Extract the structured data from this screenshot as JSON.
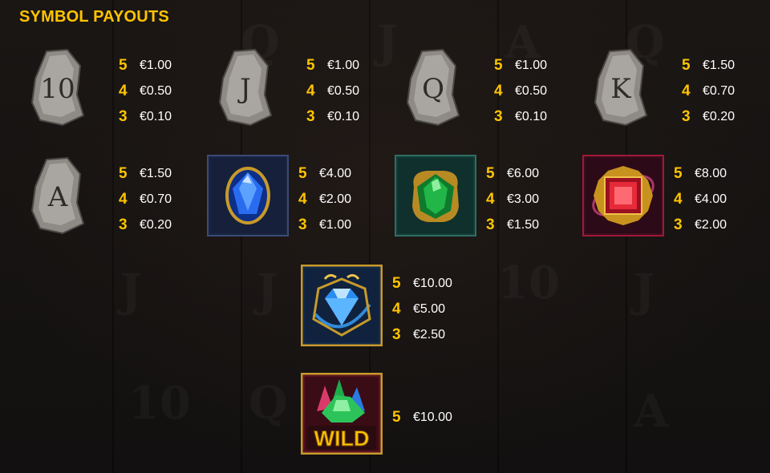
{
  "title": "SYMBOL PAYOUTS",
  "symbols": [
    {
      "icon": "rune-10-icon",
      "payouts": [
        {
          "count": "5",
          "amount": "€1.00"
        },
        {
          "count": "4",
          "amount": "€0.50"
        },
        {
          "count": "3",
          "amount": "€0.10"
        }
      ]
    },
    {
      "icon": "rune-j-icon",
      "payouts": [
        {
          "count": "5",
          "amount": "€1.00"
        },
        {
          "count": "4",
          "amount": "€0.50"
        },
        {
          "count": "3",
          "amount": "€0.10"
        }
      ]
    },
    {
      "icon": "rune-q-icon",
      "payouts": [
        {
          "count": "5",
          "amount": "€1.00"
        },
        {
          "count": "4",
          "amount": "€0.50"
        },
        {
          "count": "3",
          "amount": "€0.10"
        }
      ]
    },
    {
      "icon": "rune-k-icon",
      "payouts": [
        {
          "count": "5",
          "amount": "€1.50"
        },
        {
          "count": "4",
          "amount": "€0.70"
        },
        {
          "count": "3",
          "amount": "€0.20"
        }
      ]
    },
    {
      "icon": "rune-a-icon",
      "payouts": [
        {
          "count": "5",
          "amount": "€1.50"
        },
        {
          "count": "4",
          "amount": "€0.70"
        },
        {
          "count": "3",
          "amount": "€0.20"
        }
      ]
    },
    {
      "icon": "blue-gem-icon",
      "payouts": [
        {
          "count": "5",
          "amount": "€4.00"
        },
        {
          "count": "4",
          "amount": "€2.00"
        },
        {
          "count": "3",
          "amount": "€1.00"
        }
      ]
    },
    {
      "icon": "green-gem-icon",
      "payouts": [
        {
          "count": "5",
          "amount": "€6.00"
        },
        {
          "count": "4",
          "amount": "€3.00"
        },
        {
          "count": "3",
          "amount": "€1.50"
        }
      ]
    },
    {
      "icon": "red-gem-icon",
      "payouts": [
        {
          "count": "5",
          "amount": "€8.00"
        },
        {
          "count": "4",
          "amount": "€4.00"
        },
        {
          "count": "3",
          "amount": "€2.00"
        }
      ]
    },
    {
      "icon": "diamond-icon",
      "payouts": [
        {
          "count": "5",
          "amount": "€10.00"
        },
        {
          "count": "4",
          "amount": "€5.00"
        },
        {
          "count": "3",
          "amount": "€2.50"
        }
      ]
    },
    {
      "icon": "wild-icon",
      "wild_text": "WILD",
      "payouts": [
        {
          "count": "5",
          "amount": "€10.00"
        }
      ]
    }
  ],
  "rune_letters": [
    "10",
    "J",
    "Q",
    "K",
    "A"
  ],
  "colors": {
    "accent": "#ffc400",
    "text": "#ffffff",
    "background": "#141110"
  }
}
